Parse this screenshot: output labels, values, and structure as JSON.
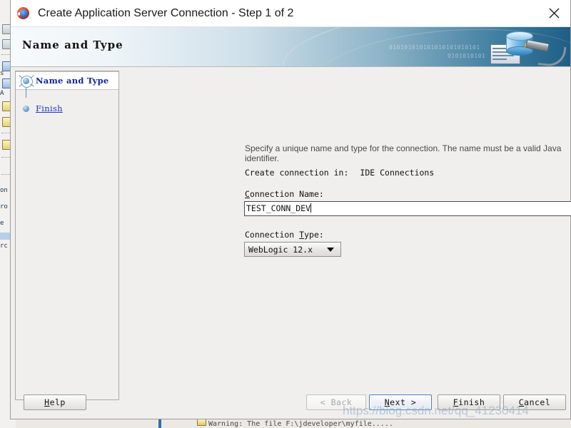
{
  "window": {
    "title": "Create Application Server Connection - Step 1 of 2",
    "app_icon": "jdeveloper-icon",
    "close_icon": "close-icon"
  },
  "banner": {
    "title": "Name and Type",
    "binary_1": "010101010101010101010101",
    "binary_2": "0101010101",
    "art_icon": "database-connection-icon"
  },
  "steps": {
    "items": [
      {
        "label": "Name and Type",
        "state": "current",
        "icon": "current-step-icon"
      },
      {
        "label": "Finish",
        "state": "pending",
        "icon": "step-dot-icon"
      }
    ]
  },
  "main": {
    "description": "Specify a unique name and type for the connection. The name must be a valid Java identifier.",
    "create_in_label": "Create connection in:",
    "create_in_value": "IDE Connections",
    "connection_name": {
      "label_pre": "C",
      "label_post": "onnection Name:",
      "value": "TEST_CONN_DEV"
    },
    "connection_type": {
      "label_pre": "Connection ",
      "label_mn": "T",
      "label_post": "ype:",
      "value": "WebLogic 12.x",
      "arrow_icon": "chevron-down-icon"
    }
  },
  "buttons": {
    "help": {
      "mn": "H",
      "rest": "elp",
      "disabled": false
    },
    "back": {
      "text": "< Back",
      "mn": "B",
      "disabled": true
    },
    "next": {
      "mn": "N",
      "rest": "ext >",
      "disabled": false,
      "focused": true
    },
    "finish": {
      "mn": "F",
      "rest": "inish",
      "disabled": false
    },
    "cancel": {
      "mn": "C",
      "rest": "ancel",
      "disabled": false
    }
  },
  "watermark": {
    "text": "https://blog.csdn.net/qq_41230414"
  },
  "background": {
    "text_fragments": [
      "s",
      "A",
      "on",
      "ro",
      "e",
      "rc"
    ],
    "log_line": "Warning: The file F:\\jdeveloper\\myfile.....",
    "grip_icon": "resize-grip-icon"
  },
  "colors": {
    "accent": "#1e5e86",
    "link": "#1a34c4",
    "step_current_text": "#10259b",
    "focus_border": "#4a7fbf"
  }
}
